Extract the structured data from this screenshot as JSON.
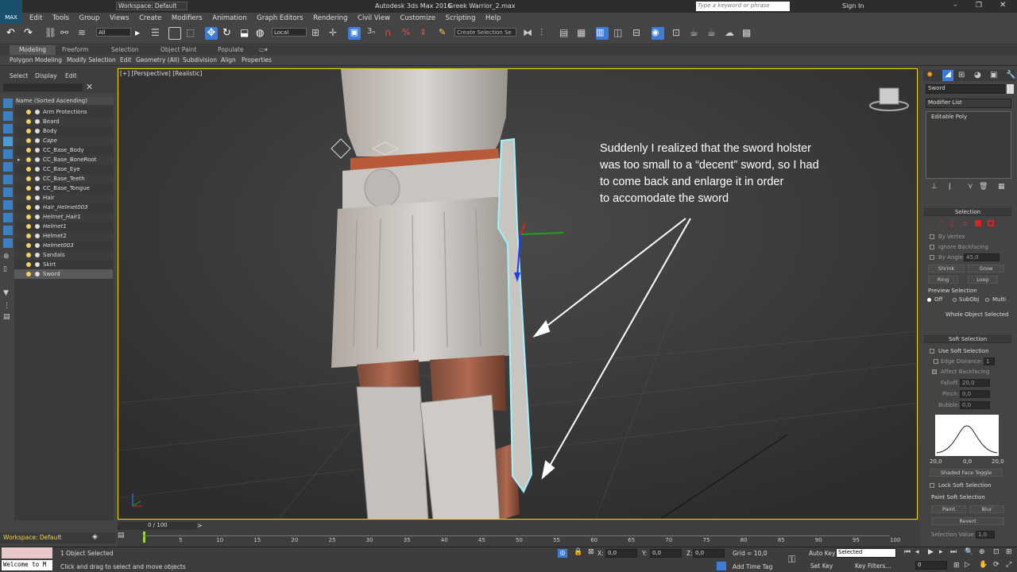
{
  "window": {
    "title": "Autodesk 3ds Max 2016",
    "file": "Greek Warrior_2.max",
    "workspace": "Workspace: Default",
    "search_placeholder": "Type a keyword or phrase",
    "sign_in": "Sign In",
    "logo": "MAX"
  },
  "menu": [
    "Edit",
    "Tools",
    "Group",
    "Views",
    "Create",
    "Modifiers",
    "Animation",
    "Graph Editors",
    "Rendering",
    "Civil View",
    "Customize",
    "Scripting",
    "Help"
  ],
  "toolbar": {
    "filter": "All",
    "coord": "Local",
    "selection_set": "Create Selection Se"
  },
  "ribbon": {
    "tabs": [
      "Modeling",
      "Freeform",
      "Selection",
      "Object Paint",
      "Populate"
    ],
    "items": [
      "Polygon Modeling",
      "Modify Selection",
      "Edit",
      "Geometry (All)",
      "Subdivision",
      "Align",
      "Properties"
    ]
  },
  "scene_explorer": {
    "menu": [
      "Select",
      "Display",
      "Edit"
    ],
    "column_header": "Name (Sorted Ascending)",
    "items": [
      "Arm Protections",
      "Beard",
      "Body",
      "Cape",
      "CC_Base_Body",
      "CC_Base_BoneRoot",
      "CC_Base_Eye",
      "CC_Base_Teeth",
      "CC_Base_Tongue",
      "Hair",
      "Hair_Helmet003",
      "Helmet_Hair1",
      "Helmet1",
      "Helmet2",
      "Helmet003",
      "Sandals",
      "Skirt",
      "Sword"
    ],
    "selected": "Sword"
  },
  "viewport": {
    "label": "[+] [Perspective] [Realistic]",
    "annotation": [
      "Suddenly I realized that the sword holster",
      "was too small to a “decent” sword, so I had",
      "to come back and enlarge it in order",
      "to accomodate the sword"
    ]
  },
  "command_panel": {
    "object_name": "Sword",
    "modifier_list": "Modifier List",
    "stack_item": "Editable Poly",
    "selection_title": "Selection",
    "by_vertex": "By Vertex",
    "ignore_backfacing": "Ignore Backfacing",
    "by_angle": "By Angle:",
    "by_angle_value": "45,0",
    "shrink": "Shrink",
    "grow": "Grow",
    "ring": "Ring",
    "loop": "Loop",
    "preview_selection": "Preview Selection",
    "preview_off": "Off",
    "preview_subobj": "SubObj",
    "preview_multi": "Multi",
    "whole_object": "Whole Object Selected",
    "soft_title": "Soft Selection",
    "use_soft": "Use Soft Selection",
    "edge_distance": "Edge Distance:",
    "edge_distance_value": "1",
    "affect_backfacing": "Affect Backfacing",
    "falloff": "Falloff:",
    "falloff_value": "20,0",
    "pinch": "Pinch:",
    "pinch_value": "0,0",
    "bubble": "Bubble:",
    "bubble_value": "0,0",
    "curve_labels": [
      "20,0",
      "0,0",
      "20,0"
    ],
    "shaded_face_toggle": "Shaded Face Toggle",
    "lock_soft": "Lock Soft Selection",
    "paint_soft": "Paint Soft Selection",
    "paint": "Paint",
    "blur": "Blur",
    "revert": "Revert",
    "selection_value": "Selection Value",
    "selection_value_num": "1,0"
  },
  "timeline": {
    "frame": "0 / 100",
    "ticks": [
      "5",
      "10",
      "15",
      "20",
      "25",
      "30",
      "35",
      "40",
      "45",
      "50",
      "55",
      "60",
      "65",
      "70",
      "75",
      "80",
      "85",
      "90",
      "95",
      "100"
    ]
  },
  "status": {
    "workspace": "Workspace: Default",
    "welcome": "Welcome to M",
    "objects_selected": "1 Object Selected",
    "prompt": "Click and drag to select and move objects",
    "x_label": "X:",
    "x": "0,0",
    "y_label": "Y:",
    "y": "0,0",
    "z_label": "Z:",
    "z": "0,0",
    "grid": "Grid = 10,0",
    "add_time_tag": "Add Time Tag",
    "auto_key": "Auto Key",
    "selected": "Selected",
    "set_key": "Set Key",
    "key_filters": "Key Filters...",
    "frame_field": "0"
  },
  "colors": {
    "accent": "#1e90ff",
    "selection_outline": "#9ff3ff",
    "viewport_border": "#ffd700"
  }
}
